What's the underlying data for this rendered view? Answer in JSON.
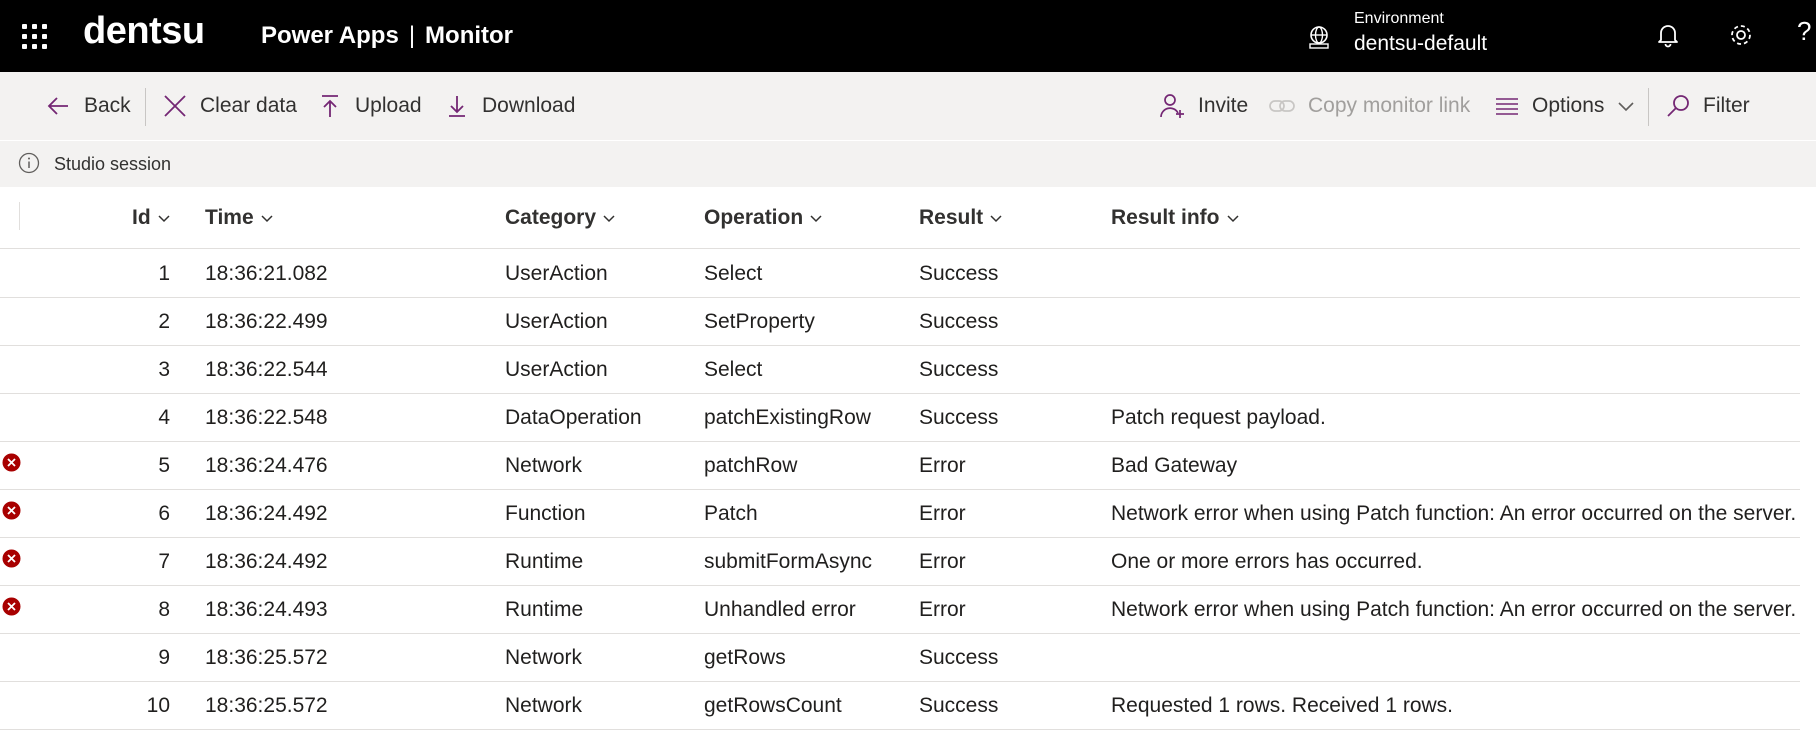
{
  "topbar": {
    "brand": "dentsu",
    "app": "Power Apps",
    "separator": "|",
    "page": "Monitor",
    "environment_label": "Environment",
    "environment_value": "dentsu-default",
    "help": "?"
  },
  "commands": {
    "back": "Back",
    "clear": "Clear data",
    "upload": "Upload",
    "download": "Download",
    "invite": "Invite",
    "copy_link": "Copy monitor link",
    "options": "Options",
    "filter": "Filter"
  },
  "session": {
    "text": "Studio session"
  },
  "table": {
    "columns": {
      "id": "Id",
      "time": "Time",
      "category": "Category",
      "operation": "Operation",
      "result": "Result",
      "result_info": "Result info"
    },
    "rows": [
      {
        "id": "1",
        "time": "18:36:21.082",
        "category": "UserAction",
        "operation": "Select",
        "result": "Success",
        "info": "",
        "error": false
      },
      {
        "id": "2",
        "time": "18:36:22.499",
        "category": "UserAction",
        "operation": "SetProperty",
        "result": "Success",
        "info": "",
        "error": false
      },
      {
        "id": "3",
        "time": "18:36:22.544",
        "category": "UserAction",
        "operation": "Select",
        "result": "Success",
        "info": "",
        "error": false
      },
      {
        "id": "4",
        "time": "18:36:22.548",
        "category": "DataOperation",
        "operation": "patchExistingRow",
        "result": "Success",
        "info": "Patch request payload.",
        "error": false
      },
      {
        "id": "5",
        "time": "18:36:24.476",
        "category": "Network",
        "operation": "patchRow",
        "result": "Error",
        "info": "Bad Gateway",
        "error": true
      },
      {
        "id": "6",
        "time": "18:36:24.492",
        "category": "Function",
        "operation": "Patch",
        "result": "Error",
        "info": "Network error when using Patch function: An error occurred on the server.",
        "error": true
      },
      {
        "id": "7",
        "time": "18:36:24.492",
        "category": "Runtime",
        "operation": "submitFormAsync",
        "result": "Error",
        "info": "One or more errors has occurred.",
        "error": true
      },
      {
        "id": "8",
        "time": "18:36:24.493",
        "category": "Runtime",
        "operation": "Unhandled error",
        "result": "Error",
        "info": "Network error when using Patch function: An error occurred on the server.",
        "error": true
      },
      {
        "id": "9",
        "time": "18:36:25.572",
        "category": "Network",
        "operation": "getRows",
        "result": "Success",
        "info": "",
        "error": false
      },
      {
        "id": "10",
        "time": "18:36:25.572",
        "category": "Network",
        "operation": "getRowsCount",
        "result": "Success",
        "info": "Requested 1 rows. Received 1 rows.",
        "error": false
      }
    ]
  },
  "colors": {
    "topbar_bg": "#000000",
    "commandbar_bg": "#f3f2f1",
    "accent_purple": "#742774",
    "error_red": "#a80000"
  }
}
